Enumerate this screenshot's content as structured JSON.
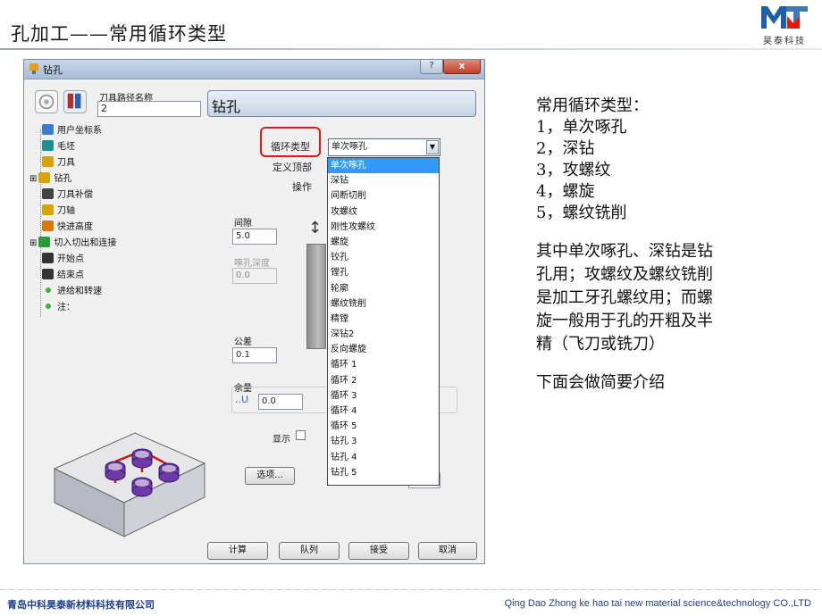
{
  "slide": {
    "title": "孔加工——常用循环类型",
    "logo_text": "昊泰科技",
    "colors": {
      "accent_red": "#e4180c",
      "brand_blue": "#1f3f8c",
      "selection": "#3399ff"
    }
  },
  "dialog": {
    "title": "钻孔",
    "help_label": "?",
    "close_label": "x",
    "path_name_label": "刀具路径名称",
    "path_name_value": "2",
    "panel_header": "钻孔",
    "tree": [
      {
        "label": "用户坐标系",
        "icon": "ucs-icon"
      },
      {
        "label": "毛坯",
        "icon": "block-icon"
      },
      {
        "label": "刀具",
        "icon": "tool-icon"
      },
      {
        "label": "钻孔",
        "icon": "drill-icon",
        "expander": "⊞"
      },
      {
        "label": "刀具补偿",
        "icon": "tool-comp-icon"
      },
      {
        "label": "刀轴",
        "icon": "tool-axis-icon"
      },
      {
        "label": "快进高度",
        "icon": "rapid-height-icon"
      },
      {
        "label": "切入切出和连接",
        "icon": "leads-links-icon",
        "expander": "⊞"
      },
      {
        "label": "开始点",
        "icon": "start-point-icon"
      },
      {
        "label": "结束点",
        "icon": "end-point-icon"
      },
      {
        "label": "进给和转速",
        "icon": "feed-speed-icon"
      },
      {
        "label": "注：",
        "icon": "note-icon"
      }
    ],
    "cycle_type_label": "循环类型",
    "cycle_type_value": "单次啄孔",
    "define_top_label": "定义顶部",
    "operation_label": "操作",
    "cycle_options": [
      "单次啄孔",
      "深钻",
      "间断切削",
      "攻螺纹",
      "刚性攻螺纹",
      "螺旋",
      "铰孔",
      "镗孔",
      "轮廓",
      "螺纹铣削",
      "精镗",
      "深钻2",
      "反向螺旋",
      "循环 1",
      "循环 2",
      "循环 3",
      "循环 4",
      "循环 5",
      "钻孔 3",
      "钻孔 4",
      "钻孔 5"
    ],
    "selected_index": 0,
    "clearance_label": "间隙",
    "clearance_value": "5.0",
    "peck_depth_label": "啄孔深度",
    "peck_depth_value": "0.0",
    "tolerance_label": "公差",
    "tolerance_value": "0.1",
    "allowance_label": "余量",
    "allowance_value": "0.0",
    "display_label": "显示",
    "options_button": "选项...",
    "buttons": {
      "calculate": "计算",
      "queue": "队列",
      "accept": "接受",
      "cancel": "取消"
    }
  },
  "notes": {
    "heading": "常用循环类型：",
    "items": [
      "1，单次啄孔",
      "2，深钻",
      "3，攻螺纹",
      "4，螺旋",
      "5，螺纹铣削"
    ],
    "paragraph_lines": [
      "其中单次啄孔、深钻是钻",
      "孔用；攻螺纹及螺纹铣削",
      "是加工牙孔螺纹用；而螺",
      "旋一般用于孔的开粗及半",
      "精（飞刀或铣刀）"
    ],
    "closing": "下面会做简要介绍"
  },
  "footer": {
    "left": "青岛中科昊泰新材料科技有限公司",
    "right": "Qing Dao Zhong ke hao tai new material science&technology CO.,LTD"
  }
}
